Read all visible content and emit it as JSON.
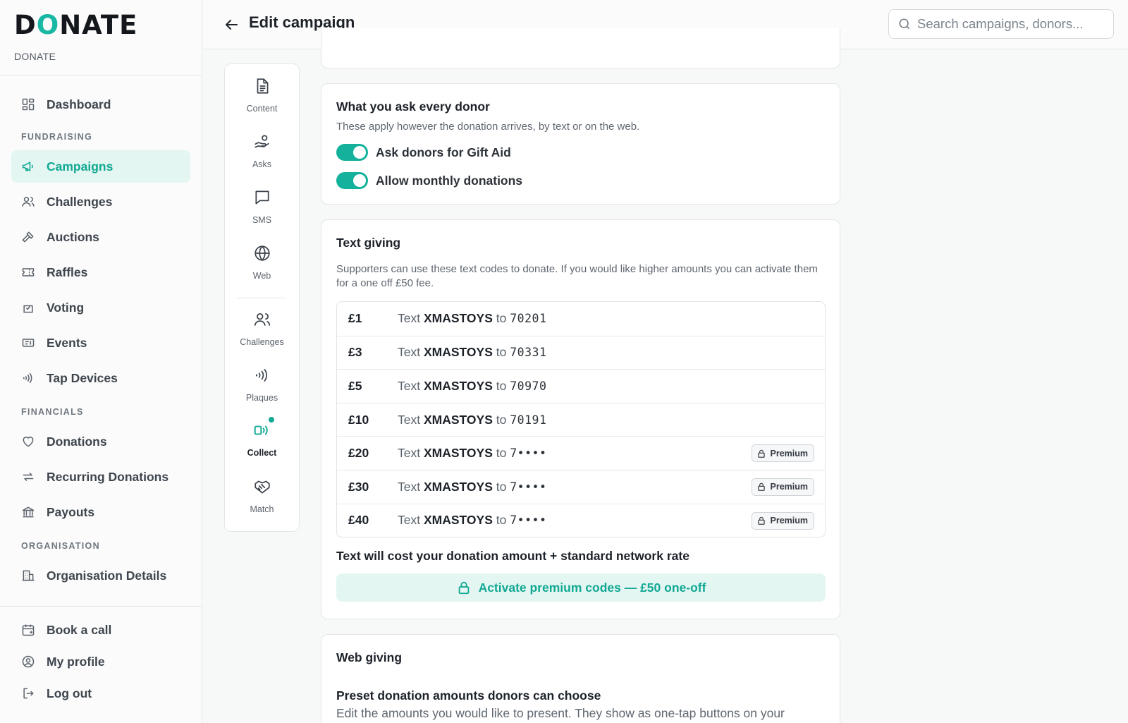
{
  "brand": {
    "logo_pre": "D",
    "logo_o": "O",
    "logo_post": "NATE",
    "subtitle": "DONATE"
  },
  "header": {
    "title": "Edit campaign",
    "search_placeholder": "Search campaigns, donors..."
  },
  "sidebar": {
    "dashboard": "Dashboard",
    "section_fundraising": "FUNDRAISING",
    "fundraising": [
      "Campaigns",
      "Challenges",
      "Auctions",
      "Raffles",
      "Voting",
      "Events",
      "Tap Devices"
    ],
    "section_financials": "FINANCIALS",
    "financials": [
      "Donations",
      "Recurring Donations",
      "Payouts"
    ],
    "section_organisation": "ORGANISATION",
    "organisation": [
      "Organisation Details"
    ],
    "bottom": [
      "Book a call",
      "My profile",
      "Log out"
    ],
    "active": "Campaigns"
  },
  "subnav": {
    "items": [
      "Content",
      "Asks",
      "SMS",
      "Web",
      "Challenges",
      "Plaques",
      "Collect",
      "Match"
    ],
    "active": "Collect"
  },
  "ask_card": {
    "title": "What you ask every donor",
    "desc": "These apply however the donation arrives, by text or on the web.",
    "toggle_gift_aid": "Ask donors for Gift Aid",
    "toggle_gift_aid_on": true,
    "toggle_monthly": "Allow monthly donations",
    "toggle_monthly_on": true
  },
  "text_card": {
    "title": "Text giving",
    "desc": "Supporters can use these text codes to donate. If you would like higher amounts you can activate them for a one off £50 fee.",
    "word_text": "Text",
    "word_to": "to",
    "keyword": "XMASTOYS",
    "codes": [
      {
        "amount": "£1",
        "number": "70201",
        "premium": false
      },
      {
        "amount": "£3",
        "number": "70331",
        "premium": false
      },
      {
        "amount": "£5",
        "number": "70970",
        "premium": false
      },
      {
        "amount": "£10",
        "number": "70191",
        "premium": false
      },
      {
        "amount": "£20",
        "number": "7••••",
        "premium": true
      },
      {
        "amount": "£30",
        "number": "7••••",
        "premium": true
      },
      {
        "amount": "£40",
        "number": "7••••",
        "premium": true
      }
    ],
    "premium_label": "Premium",
    "cost_note": "Text will cost your donation amount + standard network rate",
    "activate_label": "Activate premium codes — £50 one-off"
  },
  "web_card": {
    "title": "Web giving",
    "preset_title": "Preset donation amounts donors can choose",
    "preset_desc": "Edit the amounts you would like to present. They show as one-tap buttons on your"
  },
  "colors": {
    "accent": "#14b29c",
    "accent_bg": "#e3f6f2"
  }
}
